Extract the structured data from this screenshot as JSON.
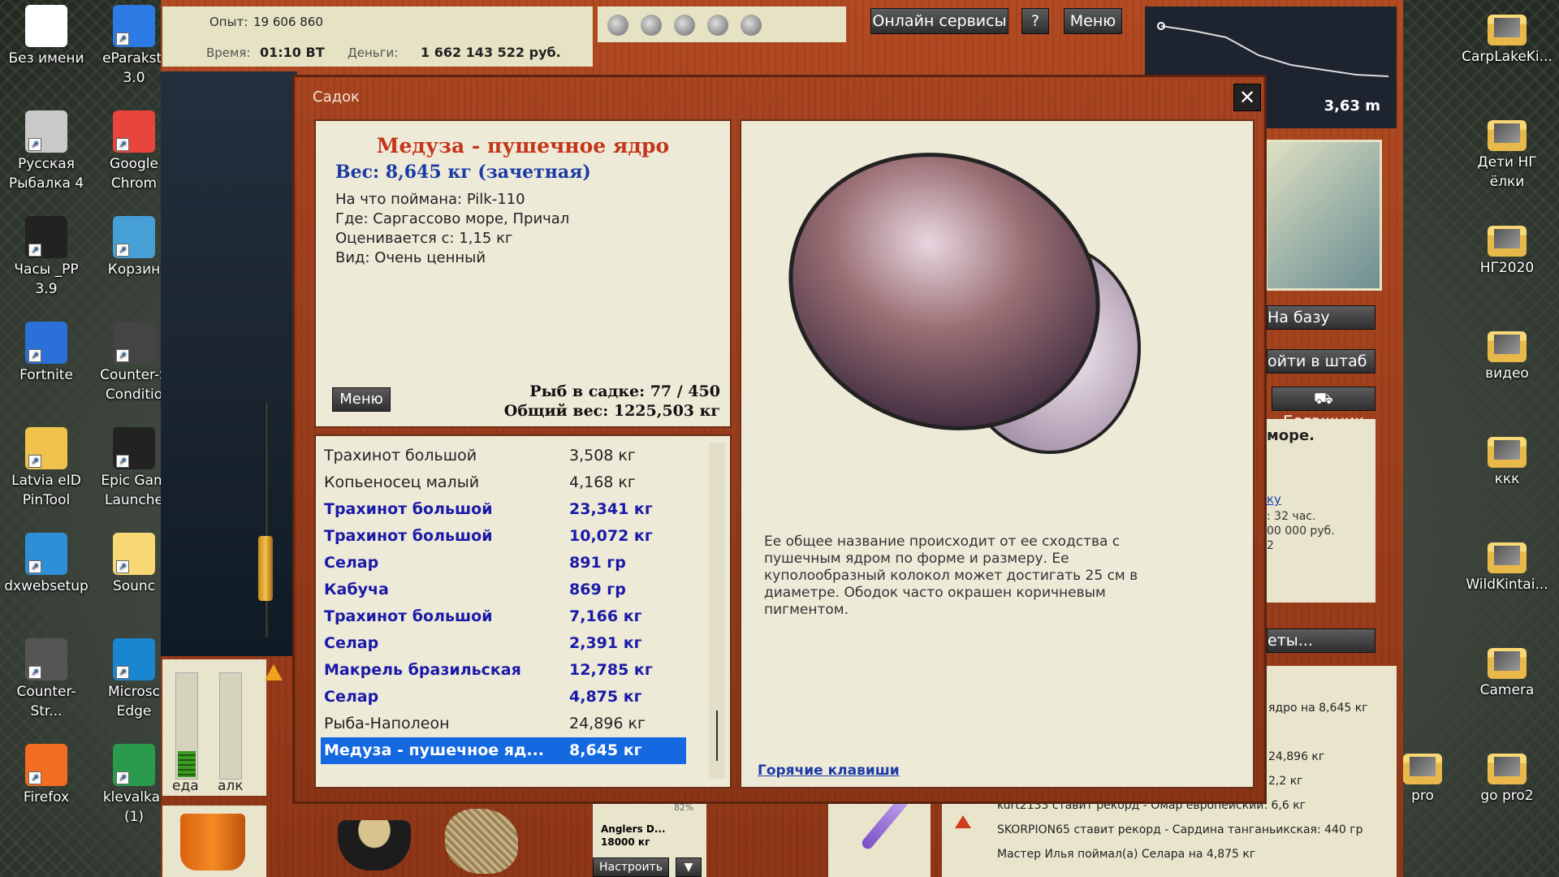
{
  "desktop": {
    "left_icons": [
      {
        "label": "Без имени",
        "x_col": 0
      },
      {
        "label": "eParaksti\n3.0",
        "x_col": 1
      },
      {
        "label": "Русская\nРыбалка 4",
        "x_col": 0
      },
      {
        "label": "Google\nChrom",
        "x_col": 1
      },
      {
        "label": "Часы _PP 3.9",
        "x_col": 0
      },
      {
        "label": "Корзин",
        "x_col": 1
      },
      {
        "label": "Fortnite",
        "x_col": 0
      },
      {
        "label": "Counter-S\nConditio",
        "x_col": 1
      },
      {
        "label": "Latvia eID\nPinTool",
        "x_col": 0
      },
      {
        "label": "Epic Gam\nLaunche",
        "x_col": 1
      },
      {
        "label": "dxwebsetup",
        "x_col": 0
      },
      {
        "label": "Sounc",
        "x_col": 1
      },
      {
        "label": "Counter-Str...",
        "x_col": 0
      },
      {
        "label": "Microsc\nEdge",
        "x_col": 1
      },
      {
        "label": "Firefox",
        "x_col": 0
      },
      {
        "label": "klevalka-\n(1)",
        "x_col": 1
      }
    ],
    "right_icons": [
      "CarpLakeKi...",
      "Дети НГ ёлки",
      "НГ2020",
      "видео",
      "ккк",
      "WildKintai...",
      "Camera",
      "go pro2",
      "pro"
    ]
  },
  "hud": {
    "exp_label": "Опыт:",
    "exp_value": "19 606 860",
    "time_label": "Время:",
    "time_value": "01:10 ВТ",
    "money_label": "Деньги:",
    "money_value": "1 662 143 522 руб.",
    "online_services": "Онлайн сервисы",
    "help": "?",
    "menu": "Меню",
    "depth": "3,63 m"
  },
  "right_panel": {
    "to_base": "На базу",
    "go_hq": "ойти в штаб",
    "trunk": "Багажник",
    "sea_text": "море.",
    "link_frag": "ку",
    "info1": ": 32 час.",
    "info2": "00 000 руб.",
    "info3": "2",
    "more": "еты..."
  },
  "dialog": {
    "title": "Садок",
    "close": "✕",
    "fish_name": "Медуза - пушечное ядро",
    "weight_line": "Вес: 8,645 кг (зачетная)",
    "caught_on": "На что поймана: Pilk-110",
    "where": "Где: Саргассово море, Причал",
    "valued_from": "Оценивается с: 1,15 кг",
    "kind": "Вид: Очень ценный",
    "menu_btn": "Меню",
    "fish_count": "Рыб в садке: 77 / 450",
    "total_weight": "Общий вес: 1225,503 кг",
    "description": "Ее общее название происходит от ее сходства с пушечным ядром по форме и размеру. Ее куполообразный колокол может достигать 25 см в диаметре. Ободок часто окрашен коричневым пигментом.",
    "hotkeys": "Горячие клавиши",
    "list": [
      {
        "name": "Трахинот большой",
        "weight": "3,508 кг",
        "style": "plain"
      },
      {
        "name": "Копьеносец малый",
        "weight": "4,168 кг",
        "style": "plain"
      },
      {
        "name": "Трахинот большой",
        "weight": "23,341 кг",
        "style": "bold"
      },
      {
        "name": "Трахинот большой",
        "weight": "10,072 кг",
        "style": "bold"
      },
      {
        "name": "Селар",
        "weight": "891 гр",
        "style": "bold"
      },
      {
        "name": "Кабуча",
        "weight": "869 гр",
        "style": "bold"
      },
      {
        "name": "Трахинот большой",
        "weight": "7,166 кг",
        "style": "bold"
      },
      {
        "name": "Селар",
        "weight": "2,391 кг",
        "style": "bold"
      },
      {
        "name": "Макрель бразильская",
        "weight": "12,785 кг",
        "style": "bold"
      },
      {
        "name": "Селар",
        "weight": "4,875 кг",
        "style": "bold"
      },
      {
        "name": "Рыба-Наполеон",
        "weight": "24,896 кг",
        "style": "plain"
      },
      {
        "name": "Медуза - пушечное яд...",
        "weight": "8,645 кг",
        "style": "selected"
      }
    ]
  },
  "status": {
    "food": "еда",
    "alc": "алк"
  },
  "bottom": {
    "anglers": "Anglers D...",
    "anglers_weight": "18000 кг",
    "percent": "82%",
    "configure": "Настроить",
    "dropdown": "▼"
  },
  "feed": [
    "ядро на 8,645 кг",
    "24,896 кг",
    "2,2 кг",
    "kurt2133 ставит рекорд - Омар европейский: 6,6 кг",
    "SKORPION65 ставит рекорд - Сардина танганьикская: 440 гр",
    "Мастер Илья поймал(а) Селара на 4,875 кг"
  ],
  "colors": {
    "title_red": "#c4361a",
    "weight_blue": "#1a3ba6",
    "selected_blue": "#1468e0",
    "wood": "#9e3d1a"
  }
}
